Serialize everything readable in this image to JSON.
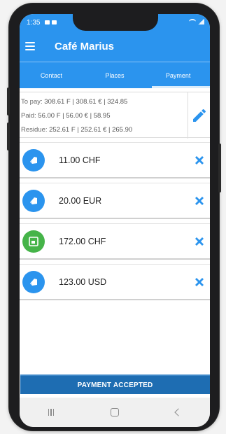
{
  "status_bar": {
    "time": "1:35"
  },
  "app_bar": {
    "title": "Café Marius"
  },
  "tabs": [
    {
      "label": "Contact"
    },
    {
      "label": "Places"
    },
    {
      "label": "Payment",
      "active": true
    }
  ],
  "summary": {
    "to_pay_label": "To pay:",
    "to_pay_value": "308.61 F | 308.61 € | 324.85",
    "paid_label": "Paid:",
    "paid_value": "56.00 F | 56.00 € | 58.95",
    "residue_label": "Residue:",
    "residue_value": "252.61 F | 252.61 € | 265.90"
  },
  "payments": [
    {
      "amount": "11.00 CHF",
      "icon": "cash-icon",
      "color": "#2b94ee"
    },
    {
      "amount": "20.00 EUR",
      "icon": "cash-icon",
      "color": "#2b94ee"
    },
    {
      "amount": "172.00 CHF",
      "icon": "card-icon",
      "color": "#45b449"
    },
    {
      "amount": "123.00 USD",
      "icon": "cash-icon",
      "color": "#2b94ee"
    }
  ],
  "accept_button": {
    "label": "PAYMENT ACCEPTED"
  },
  "colors": {
    "primary": "#2b94ee",
    "accept": "#1e6db2",
    "card": "#45b449"
  }
}
